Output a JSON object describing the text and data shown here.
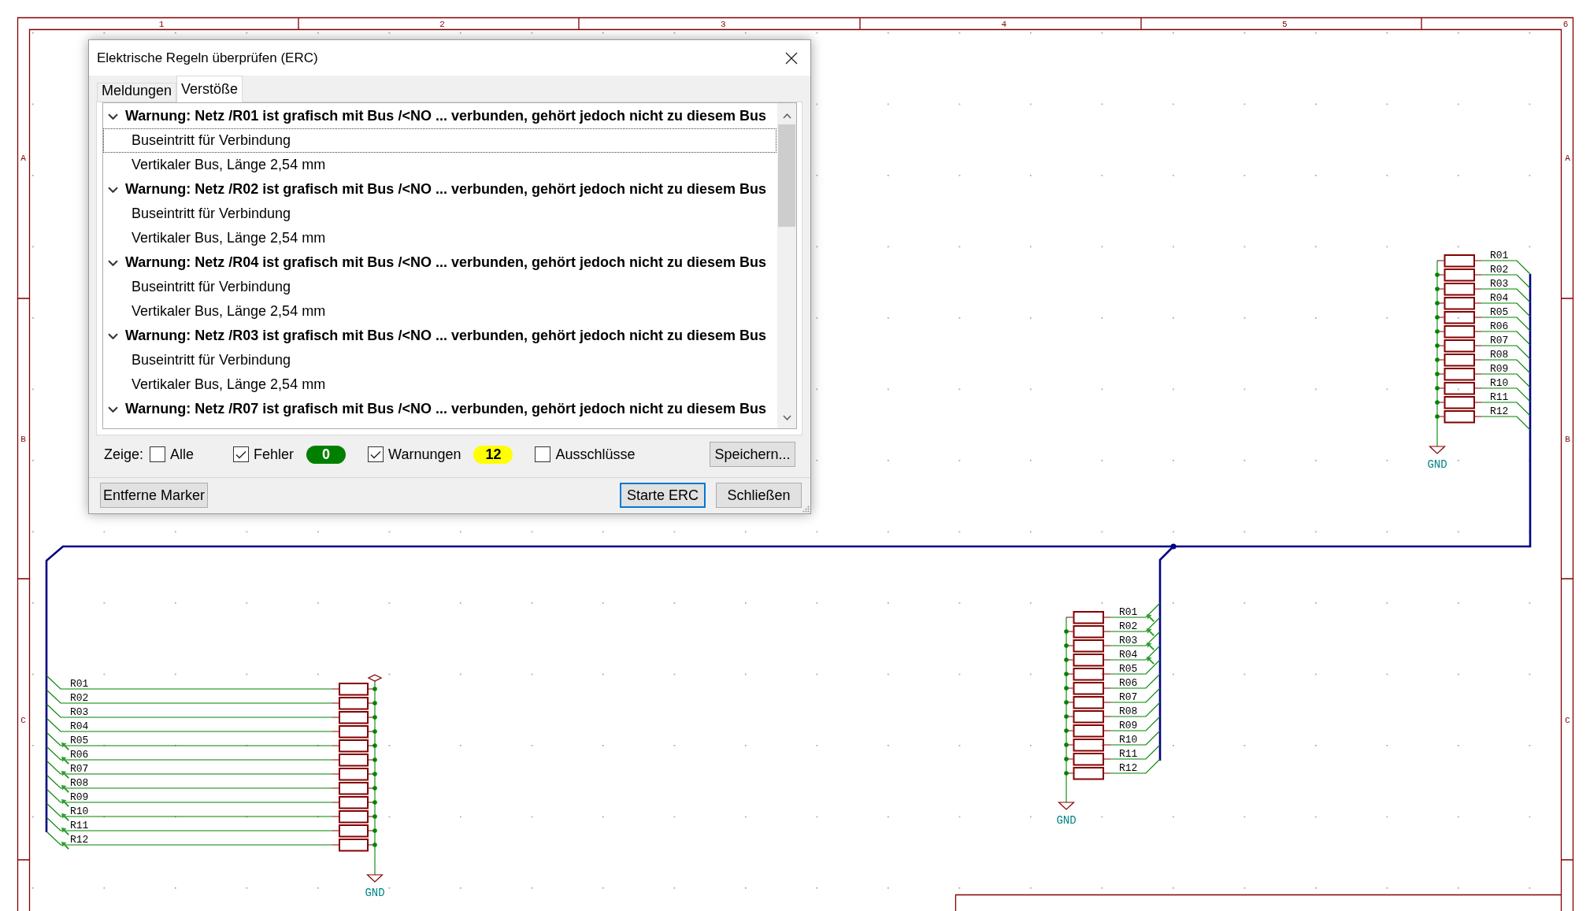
{
  "dialog": {
    "title": "Elektrische Regeln überprüfen (ERC)",
    "tabs": [
      {
        "label": "Meldungen",
        "selected": false
      },
      {
        "label": "Verstöße",
        "selected": true
      }
    ],
    "violations": [
      {
        "text": "Warnung: Netz /R01 ist grafisch mit Bus /<NO ... verbunden, gehört jedoch nicht zu diesem Bus",
        "expanded": true,
        "selected": false,
        "children": [
          {
            "text": "Buseintritt für Verbindung",
            "selected": true
          },
          {
            "text": "Vertikaler Bus, Länge 2,54 mm",
            "selected": false
          }
        ]
      },
      {
        "text": "Warnung: Netz /R02 ist grafisch mit Bus /<NO ... verbunden, gehört jedoch nicht zu diesem Bus",
        "expanded": true,
        "selected": false,
        "children": [
          {
            "text": "Buseintritt für Verbindung",
            "selected": false
          },
          {
            "text": "Vertikaler Bus, Länge 2,54 mm",
            "selected": false
          }
        ]
      },
      {
        "text": "Warnung: Netz /R04 ist grafisch mit Bus /<NO ... verbunden, gehört jedoch nicht zu diesem Bus",
        "expanded": true,
        "selected": false,
        "children": [
          {
            "text": "Buseintritt für Verbindung",
            "selected": false
          },
          {
            "text": "Vertikaler Bus, Länge 2,54 mm",
            "selected": false
          }
        ]
      },
      {
        "text": "Warnung: Netz /R03 ist grafisch mit Bus /<NO ... verbunden, gehört jedoch nicht zu diesem Bus",
        "expanded": true,
        "selected": false,
        "children": [
          {
            "text": "Buseintritt für Verbindung",
            "selected": false
          },
          {
            "text": "Vertikaler Bus, Länge 2,54 mm",
            "selected": false
          }
        ]
      },
      {
        "text": "Warnung: Netz /R07 ist grafisch mit Bus /<NO ... verbunden, gehört jedoch nicht zu diesem Bus",
        "expanded": true,
        "selected": false
      }
    ],
    "filters": {
      "label": "Zeige:",
      "options": [
        {
          "label": "Alle",
          "checked": false
        },
        {
          "label": "Fehler",
          "checked": true,
          "count": "0",
          "color": "#008000"
        },
        {
          "label": "Warnungen",
          "checked": true,
          "count": "12",
          "color": "#ffff00"
        },
        {
          "label": "Ausschlüsse",
          "checked": false
        }
      ]
    },
    "save_button": "Speichern...",
    "buttons": [
      {
        "label": "Entferne Marker",
        "default": false
      },
      {
        "label": "Starte ERC",
        "default": true
      },
      {
        "label": "Schließen",
        "default": false
      }
    ]
  },
  "schematic": {
    "frame": {
      "column_labels": [
        "1",
        "2",
        "3",
        "4",
        "5",
        "6"
      ],
      "row_labels_left": [
        "A",
        "B",
        "C"
      ],
      "row_labels_right": [
        "A",
        "B",
        "C"
      ]
    },
    "groups": [
      {
        "kind": "standard",
        "power_flag": false,
        "ground_label": "GND",
        "nets": [
          {
            "label": "R01",
            "marker": false
          },
          {
            "label": "R02",
            "marker": false
          },
          {
            "label": "R03",
            "marker": false
          },
          {
            "label": "R04",
            "marker": false
          },
          {
            "label": "R05",
            "marker": false
          },
          {
            "label": "R06",
            "marker": false
          },
          {
            "label": "R07",
            "marker": false
          },
          {
            "label": "R08",
            "marker": false
          },
          {
            "label": "R09",
            "marker": false
          },
          {
            "label": "R10",
            "marker": false
          },
          {
            "label": "R11",
            "marker": false
          },
          {
            "label": "R12",
            "marker": false
          }
        ]
      },
      {
        "kind": "standard",
        "power_flag": false,
        "ground_label": "GND",
        "nets": [
          {
            "label": "R01",
            "marker": true
          },
          {
            "label": "R02",
            "marker": true
          },
          {
            "label": "R03",
            "marker": true
          },
          {
            "label": "R04",
            "marker": true
          },
          {
            "label": "R05",
            "marker": false
          },
          {
            "label": "R06",
            "marker": false
          },
          {
            "label": "R07",
            "marker": false
          },
          {
            "label": "R08",
            "marker": false
          },
          {
            "label": "R09",
            "marker": false
          },
          {
            "label": "R10",
            "marker": false
          },
          {
            "label": "R11",
            "marker": false
          },
          {
            "label": "R12",
            "marker": false
          }
        ]
      },
      {
        "kind": "mirrored",
        "power_flag": true,
        "ground_label": "GND",
        "nets": [
          {
            "label": "R01",
            "marker": false
          },
          {
            "label": "R02",
            "marker": false
          },
          {
            "label": "R03",
            "marker": false
          },
          {
            "label": "R04",
            "marker": false
          },
          {
            "label": "R05",
            "marker": true
          },
          {
            "label": "R06",
            "marker": true
          },
          {
            "label": "R07",
            "marker": true
          },
          {
            "label": "R08",
            "marker": true
          },
          {
            "label": "R09",
            "marker": true
          },
          {
            "label": "R10",
            "marker": true
          },
          {
            "label": "R11",
            "marker": true
          },
          {
            "label": "R12",
            "marker": true
          }
        ]
      }
    ]
  }
}
